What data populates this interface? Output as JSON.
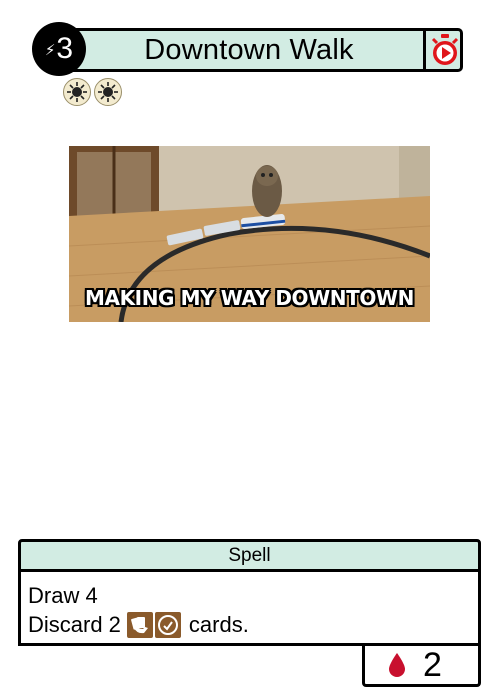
{
  "card": {
    "cost": "3",
    "title": "Downtown Walk",
    "type": "Spell",
    "rules": {
      "line1": "Draw 4",
      "line2_prefix": "Discard 2",
      "line2_suffix": "cards."
    },
    "footer_value": "2",
    "art_caption": "MAKING MY WAY DOWNTOWN"
  },
  "icons": {
    "cost": "lightning-bolt-icon",
    "timer": "stopwatch-play-icon",
    "badges": [
      "sun-icon",
      "sun-icon"
    ],
    "discard": [
      "cards-hand-icon",
      "hand-circle-icon"
    ],
    "footer": "blood-drop-icon"
  },
  "colors": {
    "header_bg": "#d2ece3",
    "timer_red": "#e0161b",
    "drop_red": "#c8102e",
    "icon_brown": "#8a5a2b"
  }
}
